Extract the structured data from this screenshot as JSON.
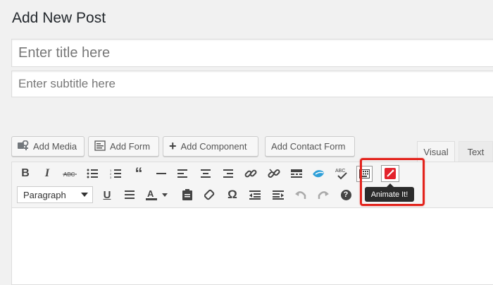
{
  "page": {
    "title": "Add New Post"
  },
  "post": {
    "title_placeholder": "Enter title here",
    "subtitle_placeholder": "Enter subtitle here"
  },
  "media_buttons": {
    "add_media": "Add Media",
    "add_form": "Add Form",
    "add_component": "Add Component",
    "add_contact_form": "Add Contact Form"
  },
  "editor_tabs": {
    "visual": "Visual",
    "text": "Text"
  },
  "toolbar": {
    "format_select": "Paragraph",
    "abc_label": "ABC",
    "omega": "Ω",
    "help": "?",
    "animate_tooltip": "Animate It!"
  },
  "colors": {
    "highlight": "#e3231c",
    "animate_icon": "#e3232c",
    "tooltip_bg": "#2b2b2b"
  }
}
